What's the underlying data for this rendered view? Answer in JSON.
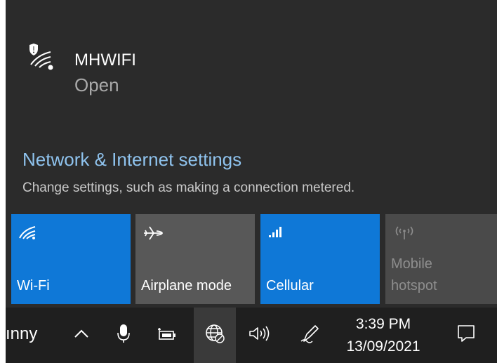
{
  "network": {
    "ssid": "MHWIFI",
    "status": "Open",
    "icon": "wifi-secured-warning-icon"
  },
  "settings": {
    "link_label": "Network & Internet settings",
    "description": "Change settings, such as making a connection metered."
  },
  "tiles": [
    {
      "label": "Wi-Fi",
      "icon": "wifi-icon",
      "state": "on"
    },
    {
      "label": "Airplane mode",
      "icon": "airplane-icon",
      "state": "off"
    },
    {
      "label": "Cellular",
      "icon": "signal-bars-icon",
      "state": "on"
    },
    {
      "label_line1": "Mobile",
      "label_line2": "hotspot",
      "icon": "hotspot-icon",
      "state": "disabled"
    }
  ],
  "taskbar": {
    "weather_text": "ınny",
    "time": "3:39 PM",
    "date": "13/09/2021",
    "icons": [
      "chevron-up-icon",
      "microphone-icon",
      "battery-icon",
      "network-globe-icon",
      "volume-icon",
      "pen-icon",
      "action-center-icon"
    ]
  },
  "colors": {
    "flyout_bg": "#2b2b2b",
    "accent": "#0f78d7",
    "link": "#8fc3ee",
    "tile_off": "#585858",
    "taskbar_bg": "#1f1f1f"
  }
}
